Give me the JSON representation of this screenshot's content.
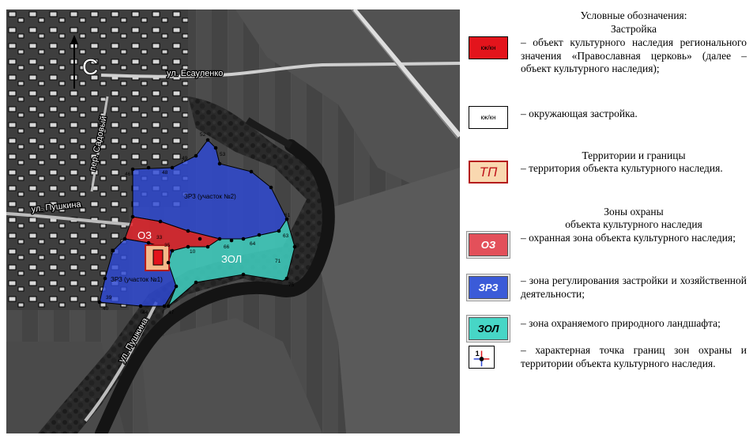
{
  "map": {
    "north_label": "С",
    "streets": [
      "ул. Есауленко",
      "пер. Садовый",
      "ул. Пушкина",
      "ул. Пушкина"
    ],
    "zone_labels": {
      "oz": "ОЗ",
      "zol": "ЗОЛ",
      "zrz2": "ЗРЗ (участок №2)",
      "zrz1": "ЗРЗ (участок №1)"
    },
    "colors": {
      "zrz": "#2e49d6",
      "oz": "#e2242c",
      "zol": "#3fd1c2",
      "church": "#e3141c",
      "points": "#000000"
    },
    "point_numbers": [
      "45",
      "46",
      "47",
      "48",
      "49",
      "50",
      "51",
      "52",
      "53",
      "55",
      "56",
      "57",
      "58",
      "59",
      "60",
      "61",
      "62",
      "63",
      "64",
      "65",
      "66",
      "67",
      "70",
      "71",
      "72",
      "73",
      "74",
      "75",
      "1",
      "2",
      "3",
      "4",
      "5",
      "6",
      "7",
      "8",
      "9",
      "10",
      "11",
      "12",
      "13",
      "32",
      "33",
      "34",
      "35",
      "36",
      "37",
      "38",
      "39",
      "40",
      "41",
      "42",
      "43",
      "44"
    ]
  },
  "legend": {
    "heading": "Условные обозначения:",
    "section_build": "Застройка",
    "kzh_label": "кж/кн",
    "heritage_text": "– объект культурного наследия регионального значения «Православная церковь» (далее – объект культурного наследия);",
    "kzh2_label": "кж/кн",
    "surround_text": "– окружающая застройка.",
    "section_territory": "Территории и границы",
    "tp_label": "ТП",
    "territory_text": "– территория объекта культурного наследия.",
    "section_zones_1": "Зоны охраны",
    "section_zones_2": "объекта культурного наследия",
    "oz_label": "ОЗ",
    "oz_text": "– охранная зона объекта культурного наследия;",
    "zrz_label": "ЗРЗ",
    "zrz_text": "– зона регулирования застройки и хозяйственной деятельности;",
    "zol_label": "ЗОЛ",
    "zol_text": "– зона охраняемого природного ландшафта;",
    "point_symbol_label": "1",
    "point_text": "– характерная точка границ зон охраны и территории объекта культурного наследия."
  }
}
